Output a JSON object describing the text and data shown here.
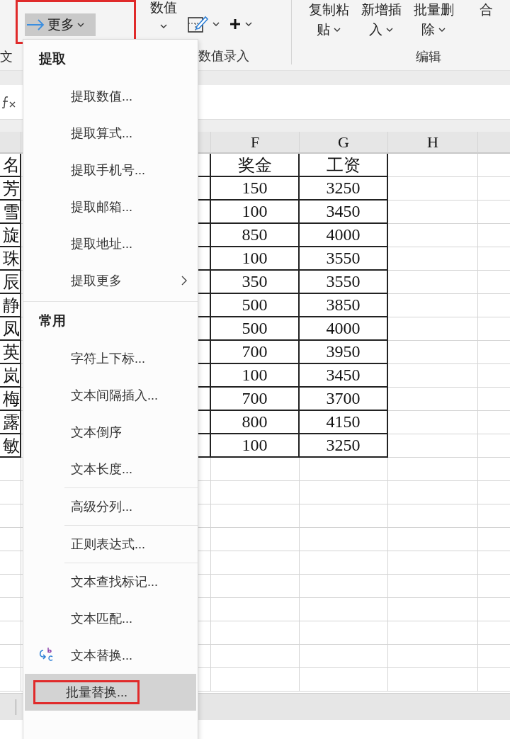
{
  "ribbon": {
    "more_button": {
      "label": "更多",
      "outlined": true
    },
    "text_group_label": "文",
    "value_button": {
      "label": "数值"
    },
    "numeric_group_label": "数值录入",
    "edit_buttons": [
      {
        "lines": [
          "复制粘",
          "贴"
        ]
      },
      {
        "lines": [
          "新增插",
          "入"
        ]
      },
      {
        "lines": [
          "批量删",
          "除"
        ]
      },
      {
        "lines": [
          "合"
        ]
      }
    ],
    "edit_group_label": "编辑"
  },
  "sheet": {
    "columns": [
      "F",
      "G",
      "H"
    ],
    "rows": [
      {
        "name": "名",
        "bonus": "奖金",
        "salary": "工资"
      },
      {
        "name": "芳",
        "bonus": "150",
        "salary": "3250"
      },
      {
        "name": "雪",
        "bonus": "100",
        "salary": "3450"
      },
      {
        "name": "旋",
        "bonus": "850",
        "salary": "4000"
      },
      {
        "name": "珠",
        "bonus": "100",
        "salary": "3550"
      },
      {
        "name": "辰",
        "bonus": "350",
        "salary": "3550"
      },
      {
        "name": "静",
        "bonus": "500",
        "salary": "3850"
      },
      {
        "name": "凤",
        "bonus": "500",
        "salary": "4000"
      },
      {
        "name": "英",
        "bonus": "700",
        "salary": "3950"
      },
      {
        "name": "岚",
        "bonus": "100",
        "salary": "3450"
      },
      {
        "name": "梅",
        "bonus": "700",
        "salary": "3700"
      },
      {
        "name": "露",
        "bonus": "800",
        "salary": "4150"
      },
      {
        "name": "敏",
        "bonus": "100",
        "salary": "3250"
      }
    ]
  },
  "menu": {
    "sections": [
      {
        "title": "提取",
        "items": [
          {
            "label": "提取数值...",
            "kind": "plain",
            "divider_before": false,
            "selected": false
          },
          {
            "label": "提取算式...",
            "kind": "plain",
            "divider_before": false,
            "selected": false
          },
          {
            "label": "提取手机号...",
            "kind": "plain",
            "divider_before": false,
            "selected": false
          },
          {
            "label": "提取邮箱...",
            "kind": "plain",
            "divider_before": false,
            "selected": false
          },
          {
            "label": "提取地址...",
            "kind": "plain",
            "divider_before": false,
            "selected": false
          },
          {
            "label": "提取更多",
            "kind": "submenu",
            "divider_before": false,
            "selected": false
          }
        ]
      },
      {
        "title": "常用",
        "items": [
          {
            "label": "字符上下标...",
            "kind": "plain",
            "divider_before": false,
            "selected": false
          },
          {
            "label": "文本间隔插入...",
            "kind": "plain",
            "divider_before": false,
            "selected": false
          },
          {
            "label": "文本倒序",
            "kind": "plain",
            "divider_before": false,
            "selected": false
          },
          {
            "label": "文本长度...",
            "kind": "plain",
            "divider_before": false,
            "selected": false
          },
          {
            "label": "高级分列...",
            "kind": "plain",
            "divider_before": true,
            "selected": false
          },
          {
            "label": "正则表达式...",
            "kind": "plain",
            "divider_before": true,
            "selected": false
          },
          {
            "label": "文本查找标记...",
            "kind": "plain",
            "divider_before": true,
            "selected": false
          },
          {
            "label": "文本匹配...",
            "kind": "plain",
            "divider_before": false,
            "selected": false
          },
          {
            "label": "文本替换...",
            "kind": "icon",
            "divider_before": false,
            "selected": false
          },
          {
            "label": "批量替换...",
            "kind": "plain",
            "divider_before": false,
            "selected": true
          }
        ]
      }
    ]
  }
}
